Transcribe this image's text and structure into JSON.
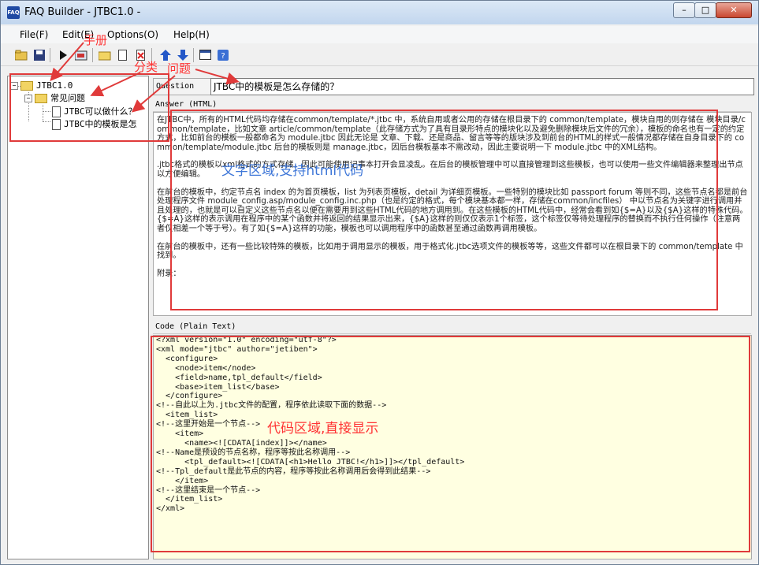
{
  "window": {
    "title": "FAQ Builder - JTBC1.0 -",
    "app_icon_label": "FAQ",
    "min_icon": "minimize-icon",
    "max_icon": "maximize-icon",
    "close_icon": "close-icon"
  },
  "menu": {
    "items": [
      {
        "label": "File(F)"
      },
      {
        "label": "Edit(E)"
      },
      {
        "label": "Options(O)"
      },
      {
        "label": "Help(H)"
      }
    ]
  },
  "toolbar": {
    "icons": [
      "open-folder-icon",
      "save-icon",
      "run-icon",
      "build-icon",
      "new-folder-icon",
      "new-document-icon",
      "delete-icon",
      "move-up-icon",
      "move-down-icon",
      "window-icon",
      "help-icon"
    ]
  },
  "tree": {
    "root": "JTBC1.0",
    "category": "常见问题",
    "items": [
      "JTBC可以做什么？",
      "JTBC中的模板是怎"
    ]
  },
  "question": {
    "label": "Question",
    "value": "JTBC中的模板是怎么存储的？"
  },
  "answer": {
    "label": "Answer (HTML)",
    "paragraphs": [
      "在JTBC中，所有的HTML代码均存储在common/template/*.jtbc 中，系统自用或者公用的存储在根目录下的 common/template，模块自用的则存储在 模块目录/common/template，比如文章 article/common/template（此存储方式为了具有目录形特点的模块化以及避免删除模块后文件的冗余），模板的命名也有一定的约定方式，比如前台的模板一般都命名为 module.jtbc 因此无论是 文章、下载、还是商品、留言等等的版块涉及到前台的HTML的样式一般情况都存储在自身目录下的 common/template/module.jtbc 后台的模板则是 manage.jtbc，因后台模板基本不需改动，因此主要说明一下 module.jtbc 中的XML结构。",
      ".jtbc格式的模板以xml格式的方式存储，因此可能使用记事本打开会显凌乱。在后台的模板管理中可以直接管理到这些模板，也可以使用一些文件编辑器来整理出节点以方便编辑。",
      "在前台的模板中，约定节点名 index 的为首页模板，list 为列表页模板，detail 为详细页模板。一些特别的模块比如 passport forum 等则不同，这些节点名都是前台处理程序文件 module_config.asp/module_config.inc.php（也是约定的格式，每个模块基本都一样，存储在common/incfiles） 中以节点名为关键字进行调用并且处理的，也就是可以自定义这些节点名以便在需要用到这些HTML代码的地方调用到。在这些模板的HTML代码中，经常会看到如{$=A}以及{$A}这样的特殊代码。{$=A}这样的表示调用在程序中的某个函数并将返回的结果显示出来，{$A}这样的则仅仅表示1个标签，这个标签仅等待处理程序的替换而不执行任何操作（注意两者仅相差一个等于号）。有了如{$=A}这样的功能，模板也可以调用程序中的函数甚至通过函数再调用模板。",
      "在前台的模板中，还有一些比较特殊的模板，比如用于调用显示的模板，用于格式化.jtbc选项文件的模板等等，这些文件都可以在根目录下的 common/template 中找到。",
      "附录："
    ]
  },
  "code": {
    "label": "Code (Plain Text)",
    "lines": [
      "<?xml version=\"1.0\" encoding=\"utf-8\"?>",
      "<xml mode=\"jtbc\" author=\"jetiben\">",
      "  <configure>",
      "    <node>item</node>",
      "    <field>name,tpl_default</field>",
      "    <base>item_list</base>",
      "  </configure>",
      "<!--自此以上为.jtbc文件的配置，程序依此读取下面的数据-->",
      "  <item_list>",
      "<!--这里开始是一个节点-->",
      "    <item>",
      "      <name><![CDATA[index]]></name>",
      "<!--Name是预设的节点名称，程序等按此名称调用-->",
      "      <tpl_default><![CDATA[<h1>Hello JTBC!</h1>]]></tpl_default>",
      "<!--Tpl_default是此节点的内容，程序等按此名称调用后会得到此结果-->",
      "    </item>",
      "<!--这里结束是一个节点-->",
      "  </item_list>",
      "</xml>"
    ]
  },
  "annotations": {
    "manual": "手册",
    "category": "分类",
    "question": "问题",
    "text_area": "文字区域,支持html代码",
    "code_area": "代码区域,直接显示",
    "color": "#e03a3a"
  }
}
